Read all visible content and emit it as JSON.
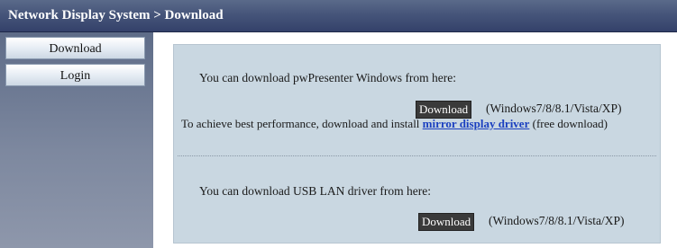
{
  "header": {
    "title": "Network Display System > Download"
  },
  "sidebar": {
    "items": [
      {
        "label": "Download"
      },
      {
        "label": "Login"
      }
    ]
  },
  "main": {
    "pwpresenter": {
      "intro": "You can download pwPresenter Windows from here:",
      "download_label": "Download",
      "os_note": "(Windows7/8/8.1/Vista/XP)",
      "perf_prefix": "To achieve best performance, download and install",
      "mirror_link": "mirror display driver",
      "perf_suffix": " (free download)"
    },
    "usb_lan": {
      "intro": "You can download USB LAN driver from here:",
      "download_label": "Download",
      "os_note": "(Windows7/8/8.1/Vista/XP)"
    }
  },
  "colors": {
    "header": "#46557a",
    "sidebar": "#7d889f",
    "panel": "#c9d7e1",
    "link": "#1a3fc0",
    "download_button": "#3a3a3a"
  }
}
